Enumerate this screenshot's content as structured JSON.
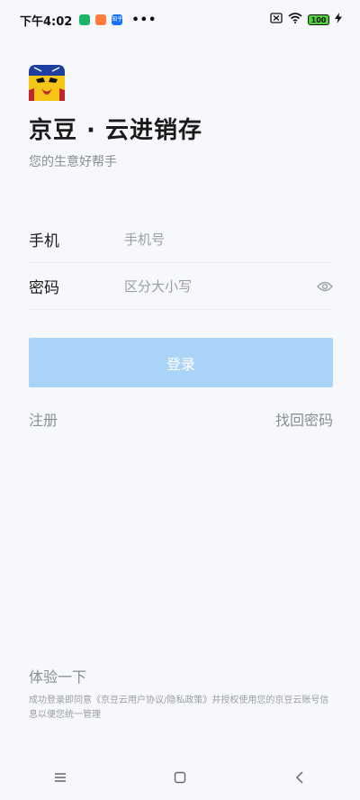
{
  "status": {
    "time": "下午4:02",
    "app_icons": [
      {
        "name": "shield-app-icon",
        "color": "#19b46a"
      },
      {
        "name": "cat-app-icon",
        "color": "#ff7a3d"
      },
      {
        "name": "zhihu-app-icon",
        "color": "#1772f6",
        "text": "知乎"
      }
    ],
    "more": "•••",
    "battery": "100",
    "colors": {
      "battery": "#4cd137"
    }
  },
  "app": {
    "title": "京豆 · 云进销存",
    "subtitle": "您的生意好帮手"
  },
  "form": {
    "phone_label": "手机",
    "phone_placeholder": "手机号",
    "password_label": "密码",
    "password_placeholder": "区分大小写"
  },
  "actions": {
    "login": "登录",
    "register": "注册",
    "recover": "找回密码",
    "try": "体验一下"
  },
  "agreement": "成功登录即同意《京豆云用户协议/隐私政策》并授权使用您的京豆云账号信息以便您统一管理",
  "colors": {
    "primary_light": "#a9d4f7",
    "background": "#f7f8fb",
    "muted": "#8a8d93"
  }
}
